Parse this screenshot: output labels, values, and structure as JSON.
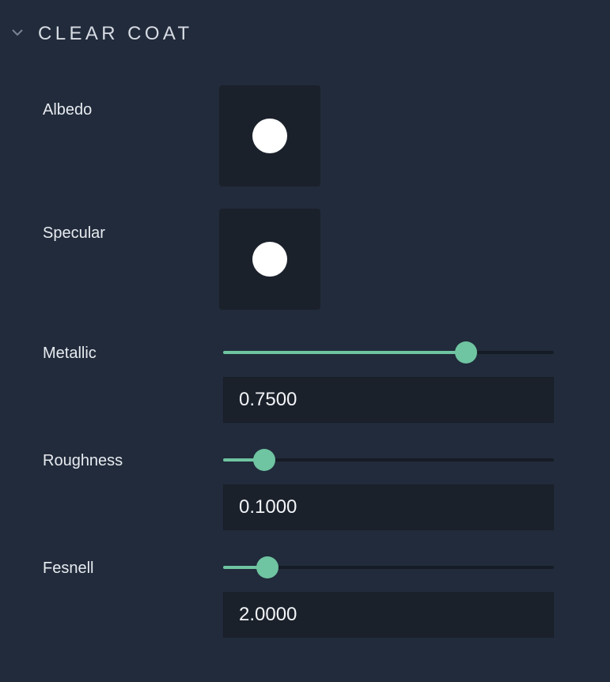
{
  "section": {
    "title": "CLEAR COAT",
    "icon": "chevron-down-icon",
    "expanded": true
  },
  "albedo": {
    "label": "Albedo",
    "color": "#ffffff"
  },
  "specular": {
    "label": "Specular",
    "color": "#ffffff"
  },
  "metallic": {
    "label": "Metallic",
    "value": "0.7500",
    "slider_fraction": 0.735
  },
  "roughness": {
    "label": "Roughness",
    "value": "0.1000",
    "slider_fraction": 0.125
  },
  "fresnel": {
    "label": "Fesnell",
    "value": "2.0000",
    "slider_fraction": 0.135
  },
  "colors": {
    "background": "#212b3b",
    "field_background": "#1b212b",
    "accent": "#6fc4a1",
    "swatch_dot": "#ffffff"
  }
}
